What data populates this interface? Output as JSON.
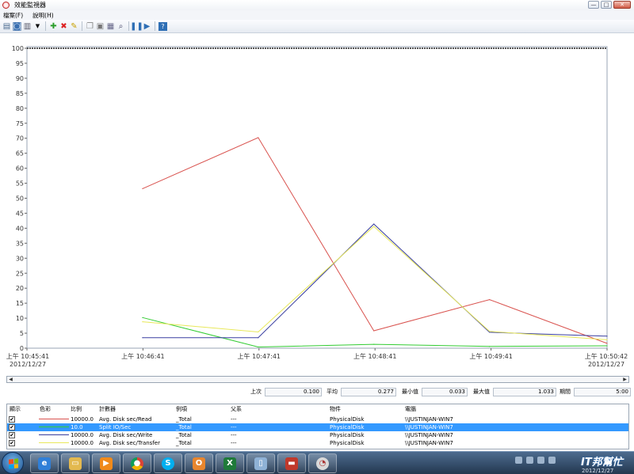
{
  "window": {
    "title": "效能監視器",
    "buttons": {
      "min": "—",
      "max": "□",
      "close": "✕"
    }
  },
  "menu": [
    "檔案(F)",
    "說明(H)"
  ],
  "toolbar": [
    "new-set-icon",
    "clear-icon",
    "view-icon",
    "dropdown-icon",
    "add-icon",
    "delete-icon",
    "highlight-icon",
    "copy-icon",
    "paste-icon",
    "properties-icon",
    "zoom-icon",
    "pause-icon",
    "update-icon",
    "help-icon"
  ],
  "chart_data": {
    "type": "line",
    "ylim": [
      0,
      100
    ],
    "y_ticks": [
      "100",
      "95",
      "90",
      "85",
      "80",
      "75",
      "70",
      "65",
      "60",
      "55",
      "50",
      "45",
      "40",
      "35",
      "30",
      "25",
      "20",
      "15",
      "10",
      "5",
      "0"
    ],
    "x_range": [
      "10:45:41",
      "10:50:42"
    ],
    "x_tick_labels": [
      {
        "time": "上午 10:45:41",
        "date": "2012/12/27"
      },
      {
        "time": "上午 10:46:41",
        "date": ""
      },
      {
        "time": "上午 10:47:41",
        "date": ""
      },
      {
        "time": "上午 10:48:41",
        "date": ""
      },
      {
        "time": "上午 10:49:41",
        "date": ""
      },
      {
        "time": "上午 10:50:42",
        "date": "2012/12/27"
      }
    ],
    "series": [
      {
        "name": "Avg. Disk sec/Read",
        "color": "#d9534f",
        "x": [
          "10:46:41",
          "10:47:41",
          "10:48:41",
          "10:49:41",
          "10:50:42"
        ],
        "values": [
          53.2,
          70.2,
          5.8,
          16.2,
          1.6
        ]
      },
      {
        "name": "Split IO/Sec",
        "color": "#33cc33",
        "x": [
          "10:46:41",
          "10:47:41",
          "10:48:41",
          "10:49:41",
          "10:50:42"
        ],
        "values": [
          10.2,
          0.4,
          1.3,
          0.6,
          0.8
        ]
      },
      {
        "name": "Avg. Disk sec/Write",
        "color": "#3a3fa0",
        "x": [
          "10:46:41",
          "10:47:41",
          "10:48:41",
          "10:49:41",
          "10:50:42"
        ],
        "values": [
          3.5,
          3.5,
          41.4,
          5.3,
          4.0
        ]
      },
      {
        "name": "Avg. Disk sec/Transfer",
        "color": "#e8e85a",
        "x": [
          "10:46:41",
          "10:47:41",
          "10:48:41",
          "10:49:41",
          "10:50:42"
        ],
        "values": [
          8.8,
          5.4,
          40.6,
          5.6,
          2.8
        ]
      }
    ]
  },
  "stats": {
    "last_label": "上次",
    "last": "0.100",
    "avg_label": "平均",
    "avg": "0.277",
    "min_label": "最小值",
    "min": "0.033",
    "max_label": "最大值",
    "max": "1.033",
    "period_label": "期間",
    "period": "5:00"
  },
  "counters": {
    "headers": [
      "顯示",
      "色彩",
      "比例",
      "計數器",
      "例項",
      "父系",
      "物件",
      "電腦"
    ],
    "rows": [
      {
        "check": "✔",
        "color": "#d9534f",
        "scale": "10000.0",
        "counter": "Avg. Disk sec/Read",
        "instance": "_Total",
        "parent": "---",
        "object": "PhysicalDisk",
        "computer": "\\\\JUSTINJAN-WIN7"
      },
      {
        "check": "✔",
        "color": "#33cc33",
        "scale": "10.0",
        "counter": "Split IO/Sec",
        "instance": "_Total",
        "parent": "---",
        "object": "PhysicalDisk",
        "computer": "\\\\JUSTINJAN-WIN7"
      },
      {
        "check": "✔",
        "color": "#3a3fa0",
        "scale": "10000.0",
        "counter": "Avg. Disk sec/Write",
        "instance": "_Total",
        "parent": "---",
        "object": "PhysicalDisk",
        "computer": "\\\\JUSTINJAN-WIN7"
      },
      {
        "check": "✔",
        "color": "#e8e85a",
        "scale": "10000.0",
        "counter": "Avg. Disk sec/Transfer",
        "instance": "_Total",
        "parent": "---",
        "object": "PhysicalDisk",
        "computer": "\\\\JUSTINJAN-WIN7"
      }
    ]
  },
  "taskbar": {
    "apps": [
      "ie-icon",
      "explorer-icon",
      "media-player-icon",
      "chrome-icon",
      "skype-icon",
      "outlook-icon",
      "excel-icon",
      "document-icon",
      "toolbox-icon",
      "perfmon-icon"
    ],
    "brand": "IT邦幫忙",
    "date": "2012/12/27"
  }
}
